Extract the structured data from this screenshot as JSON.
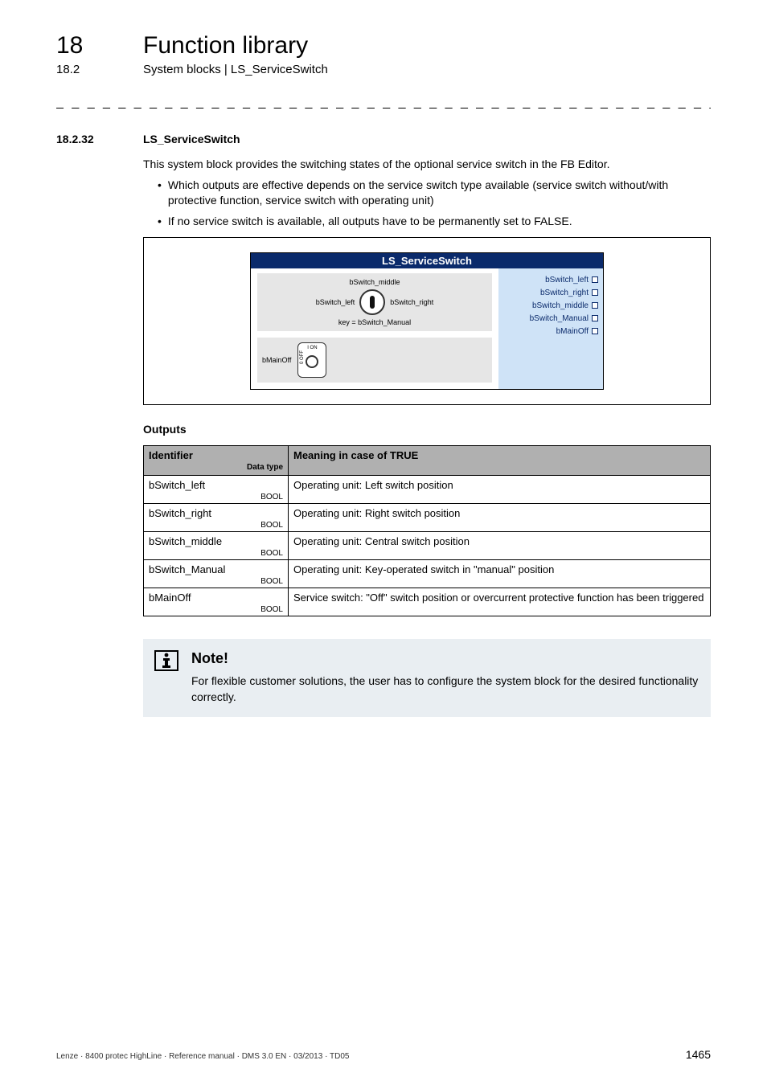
{
  "chapter": {
    "num": "18",
    "title": "Function library"
  },
  "subsection": {
    "num": "18.2",
    "title": "System blocks | LS_ServiceSwitch"
  },
  "rule": "_ _ _ _ _ _ _ _ _ _ _ _ _ _ _ _ _ _ _ _ _ _ _ _ _ _ _ _ _ _ _ _ _ _ _ _ _ _ _ _ _ _ _ _ _ _ _ _ _ _ _ _ _ _ _ _ _ _ _ _ _ _ _ _",
  "section": {
    "num": "18.2.32",
    "title": "LS_ServiceSwitch"
  },
  "intro": "This system block provides the switching states of the optional service switch in the FB Editor.",
  "bullets": [
    "Which outputs are effective depends on the service switch type available (service switch without/with protective function, service switch with operating unit)",
    "If no service switch is available, all outputs have to be permanently set to FALSE."
  ],
  "diagram": {
    "title": "LS_ServiceSwitch",
    "panel1": {
      "top": "bSwitch_middle",
      "left": "bSwitch_left",
      "right": "bSwitch_right",
      "bottom": "key = bSwitch_Manual"
    },
    "panel2": {
      "label": "bMainOff",
      "on": "I ON",
      "off": "0 OFF"
    },
    "outputs": [
      "bSwitch_left",
      "bSwitch_right",
      "bSwitch_middle",
      "bSwitch_Manual",
      "bMainOff"
    ]
  },
  "outputs_heading": "Outputs",
  "table": {
    "head_id": "Identifier",
    "head_dtype": "Data type",
    "head_meaning": "Meaning in case of TRUE",
    "rows": [
      {
        "id": "bSwitch_left",
        "dtype": "BOOL",
        "meaning": "Operating unit: Left switch position"
      },
      {
        "id": "bSwitch_right",
        "dtype": "BOOL",
        "meaning": "Operating unit: Right switch position"
      },
      {
        "id": "bSwitch_middle",
        "dtype": "BOOL",
        "meaning": "Operating unit: Central switch position"
      },
      {
        "id": "bSwitch_Manual",
        "dtype": "BOOL",
        "meaning": "Operating unit: Key-operated switch in \"manual\" position"
      },
      {
        "id": "bMainOff",
        "dtype": "BOOL",
        "meaning": "Service switch: \"Off\" switch position or overcurrent protective function has been triggered"
      }
    ]
  },
  "note": {
    "title": "Note!",
    "text": "For flexible customer solutions, the user has to configure the system block for the desired functionality correctly."
  },
  "footer": {
    "left": "Lenze · 8400 protec HighLine · Reference manual · DMS 3.0 EN · 03/2013 · TD05",
    "page": "1465"
  }
}
